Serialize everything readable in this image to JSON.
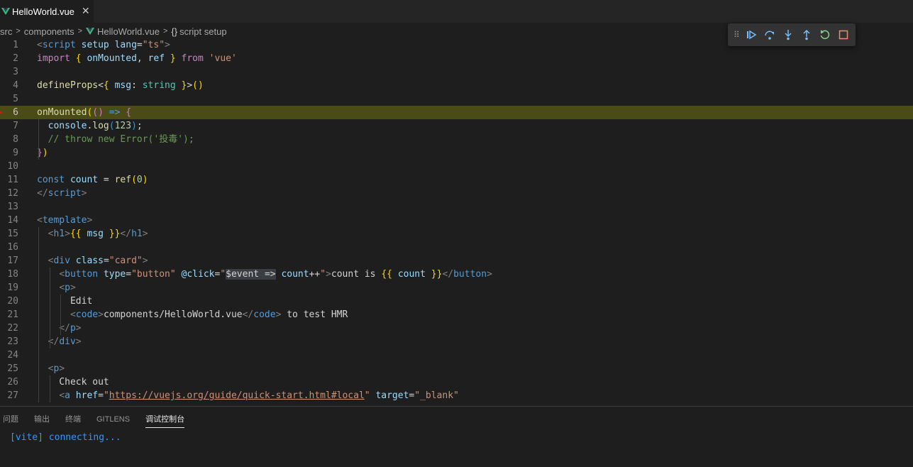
{
  "tab": {
    "label": "HelloWorld.vue",
    "close": "✕"
  },
  "breadcrumb": {
    "items": [
      "src",
      "components",
      "HelloWorld.vue",
      "script setup"
    ],
    "braces": "{}"
  },
  "debug_toolbar": {
    "buttons": [
      "continue",
      "step-over",
      "step-into",
      "step-out",
      "restart",
      "stop"
    ]
  },
  "editor": {
    "current_line": 6,
    "breakpoint_line": 6,
    "line_numbers": [
      "1",
      "2",
      "3",
      "4",
      "5",
      "6",
      "7",
      "8",
      "9",
      "10",
      "11",
      "12",
      "13",
      "14",
      "15",
      "16",
      "17",
      "18",
      "19",
      "20",
      "21",
      "22",
      "23",
      "24",
      "25",
      "26",
      "27"
    ],
    "lines": [
      [
        [
          "t-punct",
          "<"
        ],
        [
          "t-tag",
          "script"
        ],
        [
          "t-text",
          " "
        ],
        [
          "t-attr",
          "setup"
        ],
        [
          "t-text",
          " "
        ],
        [
          "t-attr",
          "lang"
        ],
        [
          "t-text",
          "="
        ],
        [
          "t-str",
          "\"ts\""
        ],
        [
          "t-punct",
          ">"
        ]
      ],
      [
        [
          "t-ctrl",
          "import"
        ],
        [
          "t-text",
          " "
        ],
        [
          "t-br1",
          "{"
        ],
        [
          "t-text",
          " "
        ],
        [
          "t-var",
          "onMounted"
        ],
        [
          "t-text",
          ", "
        ],
        [
          "t-var",
          "ref"
        ],
        [
          "t-text",
          " "
        ],
        [
          "t-br1",
          "}"
        ],
        [
          "t-text",
          " "
        ],
        [
          "t-ctrl",
          "from"
        ],
        [
          "t-text",
          " "
        ],
        [
          "t-str",
          "'vue'"
        ]
      ],
      [],
      [
        [
          "t-fn",
          "defineProps"
        ],
        [
          "t-text",
          "<"
        ],
        [
          "t-br1",
          "{"
        ],
        [
          "t-text",
          " "
        ],
        [
          "t-var",
          "msg"
        ],
        [
          "t-text",
          ": "
        ],
        [
          "t-type",
          "string"
        ],
        [
          "t-text",
          " "
        ],
        [
          "t-br1",
          "}"
        ],
        [
          "t-text",
          ">"
        ],
        [
          "t-br1",
          "()"
        ]
      ],
      [],
      [
        [
          "t-fn",
          "onMounted"
        ],
        [
          "t-br1",
          "("
        ],
        [
          "t-br2",
          "()"
        ],
        [
          "t-text",
          " "
        ],
        [
          "t-kw",
          "=>"
        ],
        [
          "t-text",
          " "
        ],
        [
          "t-br2",
          "{"
        ]
      ],
      [
        [
          "t-text",
          "  "
        ],
        [
          "t-var",
          "console"
        ],
        [
          "t-text",
          "."
        ],
        [
          "t-fn",
          "log"
        ],
        [
          "t-br3",
          "("
        ],
        [
          "t-num",
          "123"
        ],
        [
          "t-br3",
          ")"
        ],
        [
          "t-text",
          ";"
        ]
      ],
      [
        [
          "t-text",
          "  "
        ],
        [
          "t-com",
          "// throw new Error('投毒');"
        ]
      ],
      [
        [
          "t-br2",
          "}"
        ],
        [
          "t-br1",
          ")"
        ]
      ],
      [],
      [
        [
          "t-kw",
          "const"
        ],
        [
          "t-text",
          " "
        ],
        [
          "t-var",
          "count"
        ],
        [
          "t-text",
          " = "
        ],
        [
          "t-fn",
          "ref"
        ],
        [
          "t-br1",
          "("
        ],
        [
          "t-num",
          "0"
        ],
        [
          "t-br1",
          ")"
        ]
      ],
      [
        [
          "t-punct",
          "</"
        ],
        [
          "t-tag",
          "script"
        ],
        [
          "t-punct",
          ">"
        ]
      ],
      [],
      [
        [
          "t-punct",
          "<"
        ],
        [
          "t-tag",
          "template"
        ],
        [
          "t-punct",
          ">"
        ]
      ],
      [
        [
          "t-text",
          "  "
        ],
        [
          "t-punct",
          "<"
        ],
        [
          "t-tag",
          "h1"
        ],
        [
          "t-punct",
          ">"
        ],
        [
          "t-br1",
          "{{"
        ],
        [
          "t-text",
          " "
        ],
        [
          "t-var",
          "msg"
        ],
        [
          "t-text",
          " "
        ],
        [
          "t-br1",
          "}}"
        ],
        [
          "t-punct",
          "</"
        ],
        [
          "t-tag",
          "h1"
        ],
        [
          "t-punct",
          ">"
        ]
      ],
      [],
      [
        [
          "t-text",
          "  "
        ],
        [
          "t-punct",
          "<"
        ],
        [
          "t-tag",
          "div"
        ],
        [
          "t-text",
          " "
        ],
        [
          "t-attr",
          "class"
        ],
        [
          "t-text",
          "="
        ],
        [
          "t-str",
          "\"card\""
        ],
        [
          "t-punct",
          ">"
        ]
      ],
      [
        [
          "t-text",
          "    "
        ],
        [
          "t-punct",
          "<"
        ],
        [
          "t-tag",
          "button"
        ],
        [
          "t-text",
          " "
        ],
        [
          "t-attr",
          "type"
        ],
        [
          "t-text",
          "="
        ],
        [
          "t-str",
          "\"button\""
        ],
        [
          "t-text",
          " "
        ],
        [
          "t-attr",
          "@click"
        ],
        [
          "t-text",
          "="
        ],
        [
          "t-str",
          "\""
        ],
        [
          "sel",
          "$event =>"
        ],
        [
          "t-text",
          " "
        ],
        [
          "t-var",
          "count"
        ],
        [
          "t-text",
          "++"
        ],
        [
          "t-str",
          "\""
        ],
        [
          "t-punct",
          ">"
        ],
        [
          "t-text",
          "count is "
        ],
        [
          "t-br1",
          "{{"
        ],
        [
          "t-text",
          " "
        ],
        [
          "t-var",
          "count"
        ],
        [
          "t-text",
          " "
        ],
        [
          "t-br1",
          "}}"
        ],
        [
          "t-punct",
          "</"
        ],
        [
          "t-tag",
          "button"
        ],
        [
          "t-punct",
          ">"
        ]
      ],
      [
        [
          "t-text",
          "    "
        ],
        [
          "t-punct",
          "<"
        ],
        [
          "t-tag",
          "p"
        ],
        [
          "t-punct",
          ">"
        ]
      ],
      [
        [
          "t-text",
          "      Edit"
        ]
      ],
      [
        [
          "t-text",
          "      "
        ],
        [
          "t-punct",
          "<"
        ],
        [
          "t-tag",
          "code"
        ],
        [
          "t-punct",
          ">"
        ],
        [
          "t-text",
          "components/HelloWorld.vue"
        ],
        [
          "t-punct",
          "</"
        ],
        [
          "t-tag",
          "code"
        ],
        [
          "t-punct",
          ">"
        ],
        [
          "t-text",
          " to test HMR"
        ]
      ],
      [
        [
          "t-text",
          "    "
        ],
        [
          "t-punct",
          "</"
        ],
        [
          "t-tag",
          "p"
        ],
        [
          "t-punct",
          ">"
        ]
      ],
      [
        [
          "t-text",
          "  "
        ],
        [
          "t-punct",
          "</"
        ],
        [
          "t-tag",
          "div"
        ],
        [
          "t-punct",
          ">"
        ]
      ],
      [],
      [
        [
          "t-text",
          "  "
        ],
        [
          "t-punct",
          "<"
        ],
        [
          "t-tag",
          "p"
        ],
        [
          "t-punct",
          ">"
        ]
      ],
      [
        [
          "t-text",
          "    Check out"
        ]
      ],
      [
        [
          "t-text",
          "    "
        ],
        [
          "t-punct",
          "<"
        ],
        [
          "t-tag",
          "a"
        ],
        [
          "t-text",
          " "
        ],
        [
          "t-attr",
          "href"
        ],
        [
          "t-text",
          "="
        ],
        [
          "t-str",
          "\""
        ],
        [
          "t-url",
          "https://vuejs.org/guide/quick-start.html#local"
        ],
        [
          "t-str",
          "\""
        ],
        [
          "t-text",
          " "
        ],
        [
          "t-attr",
          "target"
        ],
        [
          "t-text",
          "="
        ],
        [
          "t-str",
          "\"_blank\""
        ]
      ]
    ]
  },
  "panel": {
    "tabs": [
      "问题",
      "输出",
      "终端",
      "GITLENS",
      "调试控制台"
    ],
    "active_tab": "调试控制台",
    "console_lines": [
      "[vite] connecting..."
    ]
  }
}
